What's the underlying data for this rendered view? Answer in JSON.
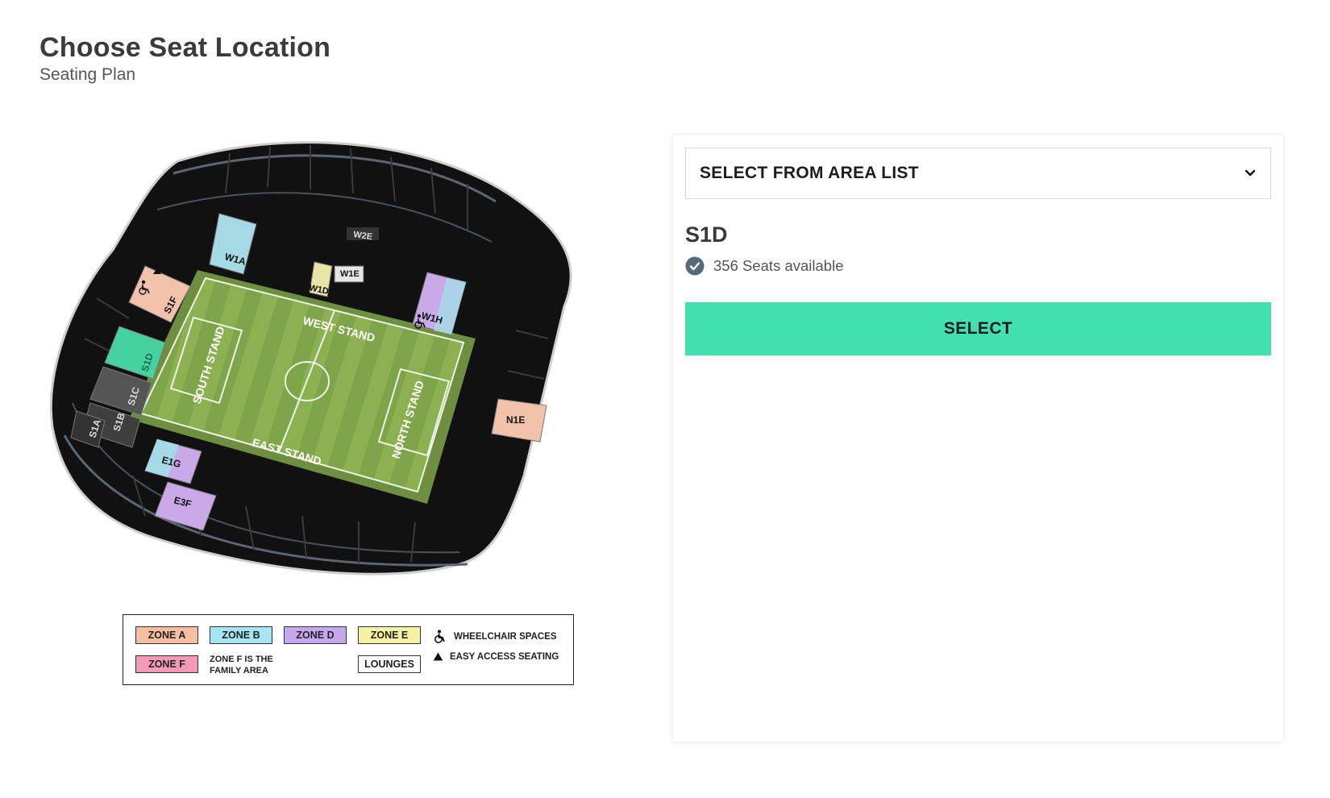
{
  "header": {
    "title": "Choose Seat Location",
    "subtitle": "Seating Plan"
  },
  "map": {
    "stands": [
      "WEST STAND",
      "SOUTH STAND",
      "EAST STAND",
      "NORTH STAND"
    ],
    "sections": [
      "W2E",
      "W1A",
      "W1E",
      "W1D",
      "W1H",
      "S1F",
      "S1D",
      "S1C",
      "S1B",
      "S1A",
      "N1E",
      "E1G",
      "E3F"
    ],
    "selected_section": "S1D"
  },
  "legend": {
    "zone_a": "ZONE A",
    "zone_b": "ZONE B",
    "zone_d": "ZONE D",
    "zone_e": "ZONE E",
    "zone_f": "ZONE F",
    "family_line1": "ZONE F IS THE",
    "family_line2": "FAMILY AREA",
    "lounges": "LOUNGES",
    "wheelchair": "WHEELCHAIR SPACES",
    "easy_access": "EASY ACCESS SEATING",
    "colors": {
      "zone_a": "#f6bfa1",
      "zone_b": "#a6e6f2",
      "zone_d": "#c7a8ef",
      "zone_e": "#f5f2a3",
      "zone_f": "#f49ab7",
      "lounges": "#ffffff"
    }
  },
  "panel": {
    "area_list_label": "SELECT FROM AREA LIST",
    "section_code": "S1D",
    "availability": "356 Seats available",
    "select_label": "SELECT",
    "accent": "#42e0ad"
  }
}
